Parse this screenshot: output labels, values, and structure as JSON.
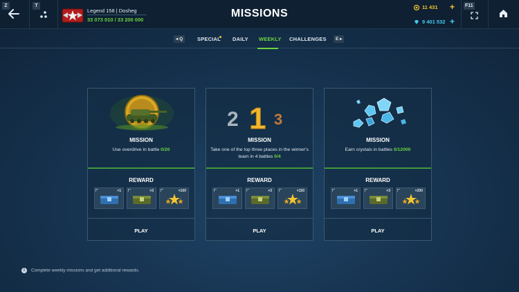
{
  "topbar": {
    "key_back": "Z",
    "key_menu": "T",
    "key_fullscreen": "F11",
    "profile_name": "Legend 158 | Dosheg",
    "profile_xp": "33 073 010 / 33 200 000",
    "title": "MISSIONS",
    "gold": "11 431",
    "crystals": "9 401 532",
    "icons": [
      "back-arrow-icon",
      "menu-dots-icon",
      "rank-emblem-icon",
      "gold-coin-icon",
      "crystal-icon",
      "plus-icon",
      "fullscreen-icon",
      "home-icon"
    ],
    "colors": {
      "gold": "#f4c430",
      "crystal": "#47c8f0",
      "accent_green": "#6bd43f"
    }
  },
  "tabs": {
    "key_prev": "Q",
    "key_next": "E",
    "items": [
      "SPECIAL",
      "DAILY",
      "WEEKLY",
      "CHALLENGES"
    ],
    "active": "WEEKLY"
  },
  "cards": [
    {
      "mission_title": "MISSION",
      "desc": "Use overdrive in battle",
      "progress": "0/20",
      "reward_title": "REWARD",
      "rewards": [
        {
          "icon": "blue-container-icon",
          "qty": "×1"
        },
        {
          "icon": "green-container-icon",
          "qty": "×3"
        },
        {
          "icon": "gold-stars-icon",
          "qty": "×100"
        }
      ],
      "play": "PLAY"
    },
    {
      "mission_title": "MISSION",
      "desc": "Take one of the top three places in the winner's team in 4 battles",
      "progress": "0/4",
      "reward_title": "REWARD",
      "rewards": [
        {
          "icon": "blue-container-icon",
          "qty": "×1"
        },
        {
          "icon": "green-container-icon",
          "qty": "×3"
        },
        {
          "icon": "gold-stars-icon",
          "qty": "×150"
        }
      ],
      "play": "PLAY"
    },
    {
      "mission_title": "MISSION",
      "desc": "Earn crystals in battles",
      "progress": "0/12000",
      "reward_title": "REWARD",
      "rewards": [
        {
          "icon": "blue-container-icon",
          "qty": "×1"
        },
        {
          "icon": "green-container-icon",
          "qty": "×3"
        },
        {
          "icon": "gold-stars-icon",
          "qty": "×200"
        }
      ],
      "play": "PLAY"
    }
  ],
  "footer": {
    "info": "Complete weekly missions and get additional rewards."
  }
}
